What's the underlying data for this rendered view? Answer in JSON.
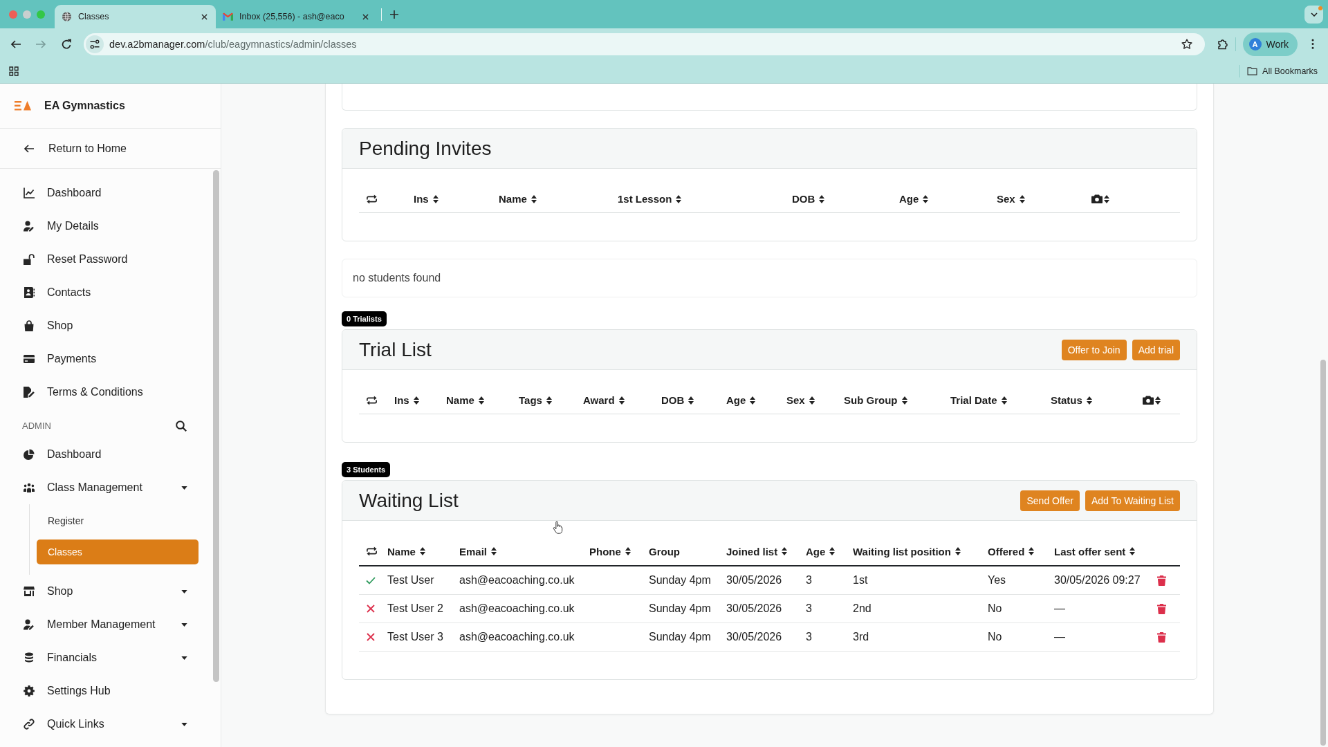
{
  "browser": {
    "tabs": [
      {
        "title": "Classes",
        "selected": true
      },
      {
        "title": "Inbox (25,556) - ash@eaco",
        "selected": false
      }
    ],
    "url": {
      "host": "dev.a2bmanager.com",
      "path": "/club/eagymnastics/admin/classes"
    },
    "profile": {
      "initial": "A",
      "label": "Work"
    },
    "bookmarks_label": "All Bookmarks"
  },
  "sidebar": {
    "brand": "EA Gymnastics",
    "back_link": "Return to Home",
    "items": [
      {
        "label": "Dashboard",
        "selected": false
      },
      {
        "label": "My Details",
        "selected": false
      },
      {
        "label": "Reset Password",
        "selected": false
      },
      {
        "label": "Contacts",
        "selected": false
      },
      {
        "label": "Shop",
        "selected": false
      },
      {
        "label": "Payments",
        "selected": false
      },
      {
        "label": "Terms & Conditions",
        "selected": false
      }
    ],
    "admin_heading": "ADMIN",
    "admin_items": [
      {
        "label": "Dashboard",
        "selected": false,
        "expandable": false
      },
      {
        "label": "Class Management",
        "selected": false,
        "expandable": true,
        "children": [
          {
            "label": "Register",
            "selected": false
          },
          {
            "label": "Classes",
            "selected": true
          }
        ]
      },
      {
        "label": "Shop",
        "selected": false,
        "expandable": true
      },
      {
        "label": "Member Management",
        "selected": false,
        "expandable": true
      },
      {
        "label": "Financials",
        "selected": false,
        "expandable": true
      },
      {
        "label": "Settings Hub",
        "selected": false,
        "expandable": false
      },
      {
        "label": "Quick Links",
        "selected": false,
        "expandable": true
      }
    ]
  },
  "pending_invites": {
    "title": "Pending Invites",
    "columns": [
      {
        "label": "Ins",
        "sortable": true
      },
      {
        "label": "Name",
        "sortable": true
      },
      {
        "label": "1st Lesson",
        "sortable": true
      },
      {
        "label": "DOB",
        "sortable": true
      },
      {
        "label": "Age",
        "sortable": true
      },
      {
        "label": "Sex",
        "sortable": true
      }
    ]
  },
  "empty_notice": "no students found",
  "trial_list": {
    "badge": "0 Trialists",
    "title": "Trial List",
    "buttons": [
      "Offer to Join",
      "Add trial"
    ],
    "columns": [
      {
        "label": "Ins",
        "sortable": true
      },
      {
        "label": "Name",
        "sortable": true
      },
      {
        "label": "Tags",
        "sortable": true
      },
      {
        "label": "Award",
        "sortable": true
      },
      {
        "label": "DOB",
        "sortable": true
      },
      {
        "label": "Age",
        "sortable": true
      },
      {
        "label": "Sex",
        "sortable": true
      },
      {
        "label": "Sub Group",
        "sortable": true
      },
      {
        "label": "Trial Date",
        "sortable": true
      },
      {
        "label": "Status",
        "sortable": true
      }
    ]
  },
  "waiting_list": {
    "badge": "3 Students",
    "title": "Waiting List",
    "buttons": [
      "Send Offer",
      "Add To Waiting List"
    ],
    "columns": [
      {
        "label": "Name",
        "sortable": true
      },
      {
        "label": "Email",
        "sortable": true
      },
      {
        "label": "Phone",
        "sortable": true
      },
      {
        "label": "Group",
        "sortable": false
      },
      {
        "label": "Joined list",
        "sortable": true
      },
      {
        "label": "Age",
        "sortable": true
      },
      {
        "label": "Waiting list position",
        "sortable": true
      },
      {
        "label": "Offered",
        "sortable": true
      },
      {
        "label": "Last offer sent",
        "sortable": true
      }
    ],
    "rows": [
      {
        "ticked": true,
        "name": "Test User",
        "email": "ash@eacoaching.co.uk",
        "group": "Sunday 4pm",
        "joined_list": "30/05/2026",
        "age": "3",
        "position": "1st",
        "offered": "Yes",
        "last_offer_sent": "30/05/2026 09:27"
      },
      {
        "ticked": false,
        "name": "Test User 2",
        "email": "ash@eacoaching.co.uk",
        "group": "Sunday 4pm",
        "joined_list": "30/05/2026",
        "age": "3",
        "position": "2nd",
        "offered": "No",
        "last_offer_sent": "—"
      },
      {
        "ticked": false,
        "name": "Test User 3",
        "email": "ash@eacoaching.co.uk",
        "group": "Sunday 4pm",
        "joined_list": "30/05/2026",
        "age": "3",
        "position": "3rd",
        "offered": "No",
        "last_offer_sent": "—"
      }
    ]
  }
}
